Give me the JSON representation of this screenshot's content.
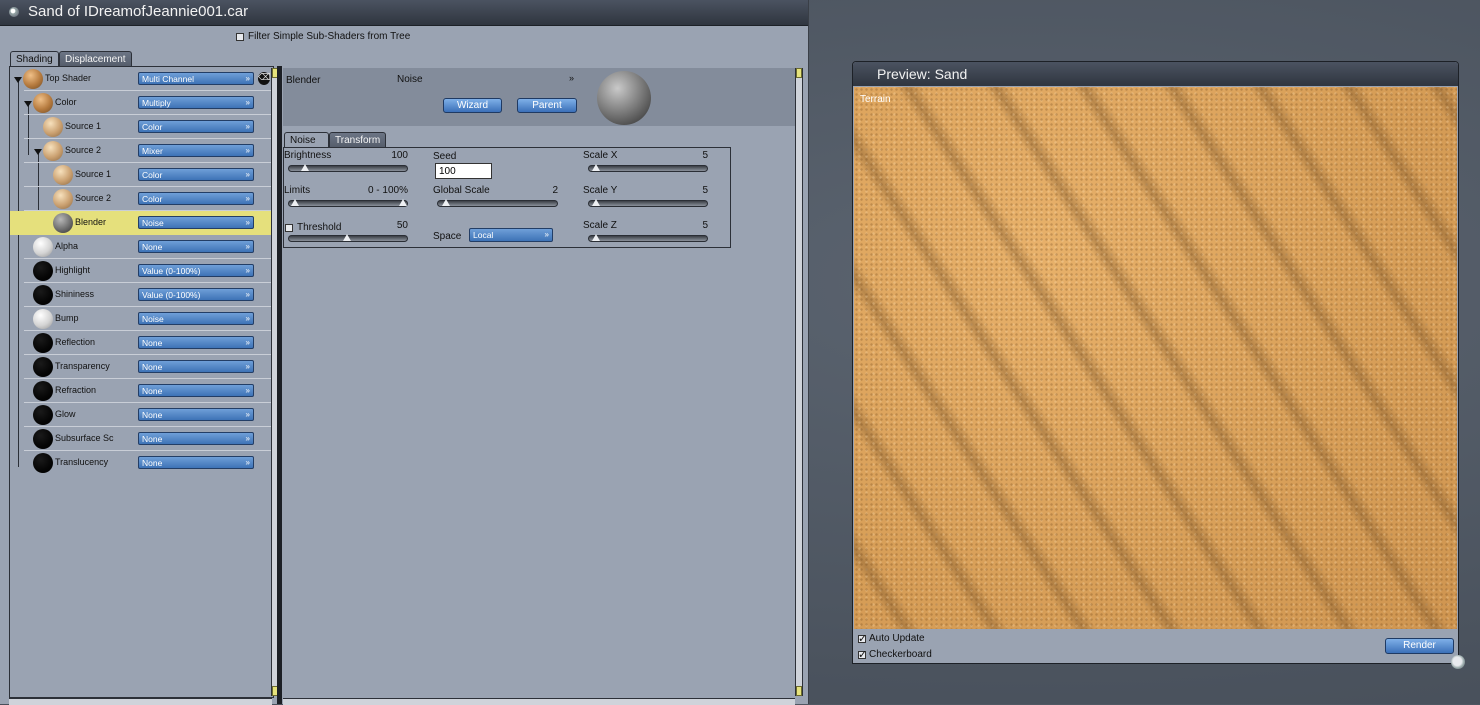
{
  "window": {
    "title": "Sand of IDreamofJeannie001.car"
  },
  "filter": {
    "label": "Filter Simple Sub-Shaders from Tree",
    "checked": false
  },
  "tabs": [
    {
      "label": "Shading"
    },
    {
      "label": "Displacement"
    }
  ],
  "tree": [
    {
      "label": "Top Shader",
      "value": "Multi Channel",
      "ball": "brown"
    },
    {
      "label": "Color",
      "value": "Multiply",
      "ball": "brown"
    },
    {
      "label": "Source 1",
      "value": "Color",
      "ball": "tan"
    },
    {
      "label": "Source 2",
      "value": "Mixer",
      "ball": "tan"
    },
    {
      "label": "Source 1",
      "value": "Color",
      "ball": "tan"
    },
    {
      "label": "Source 2",
      "value": "Color",
      "ball": "tan"
    },
    {
      "label": "Blender",
      "value": "Noise",
      "ball": "gray"
    },
    {
      "label": "Alpha",
      "value": "None",
      "ball": "white"
    },
    {
      "label": "Highlight",
      "value": "Value (0-100%)",
      "ball": "black"
    },
    {
      "label": "Shininess",
      "value": "Value (0-100%)",
      "ball": "black"
    },
    {
      "label": "Bump",
      "value": "Noise",
      "ball": "white"
    },
    {
      "label": "Reflection",
      "value": "None",
      "ball": "black"
    },
    {
      "label": "Transparency",
      "value": "None",
      "ball": "black"
    },
    {
      "label": "Refraction",
      "value": "None",
      "ball": "black"
    },
    {
      "label": "Glow",
      "value": "None",
      "ball": "black"
    },
    {
      "label": "Subsurface Sc",
      "value": "None",
      "ball": "black"
    },
    {
      "label": "Translucency",
      "value": "None",
      "ball": "black"
    }
  ],
  "detail": {
    "channel": "Blender",
    "type": "Noise",
    "wizard": "Wizard",
    "parent": "Parent",
    "tabs": [
      {
        "label": "Noise"
      },
      {
        "label": "Transform"
      }
    ],
    "brightness": {
      "label": "Brightness",
      "value": "100",
      "level": 0.1
    },
    "limits": {
      "label": "Limits",
      "value": "0 - 100%",
      "low": 0.0,
      "high": 1.0
    },
    "threshold": {
      "label": "Threshold",
      "value": "50",
      "level": 0.5,
      "checked": false
    },
    "seed": {
      "label": "Seed",
      "value": "100"
    },
    "global_scale": {
      "label": "Global Scale",
      "value": "2",
      "level": 0.02
    },
    "space": {
      "label": "Space",
      "value": "Local"
    },
    "scale_x": {
      "label": "Scale X",
      "value": "5",
      "level": 0.05
    },
    "scale_y": {
      "label": "Scale Y",
      "value": "5",
      "level": 0.05
    },
    "scale_z": {
      "label": "Scale Z",
      "value": "5",
      "level": 0.05
    }
  },
  "preview": {
    "title": "Preview: Sand",
    "image_label": "Terrain",
    "auto_update": {
      "label": "Auto Update",
      "checked": true
    },
    "checkerboard": {
      "label": "Checkerboard",
      "checked": true
    },
    "render": "Render"
  },
  "colors": {
    "panel": "#9aa3b2",
    "selected_row": "#e5e07c",
    "button": "#3e73b6",
    "sand": "#d89f58"
  }
}
